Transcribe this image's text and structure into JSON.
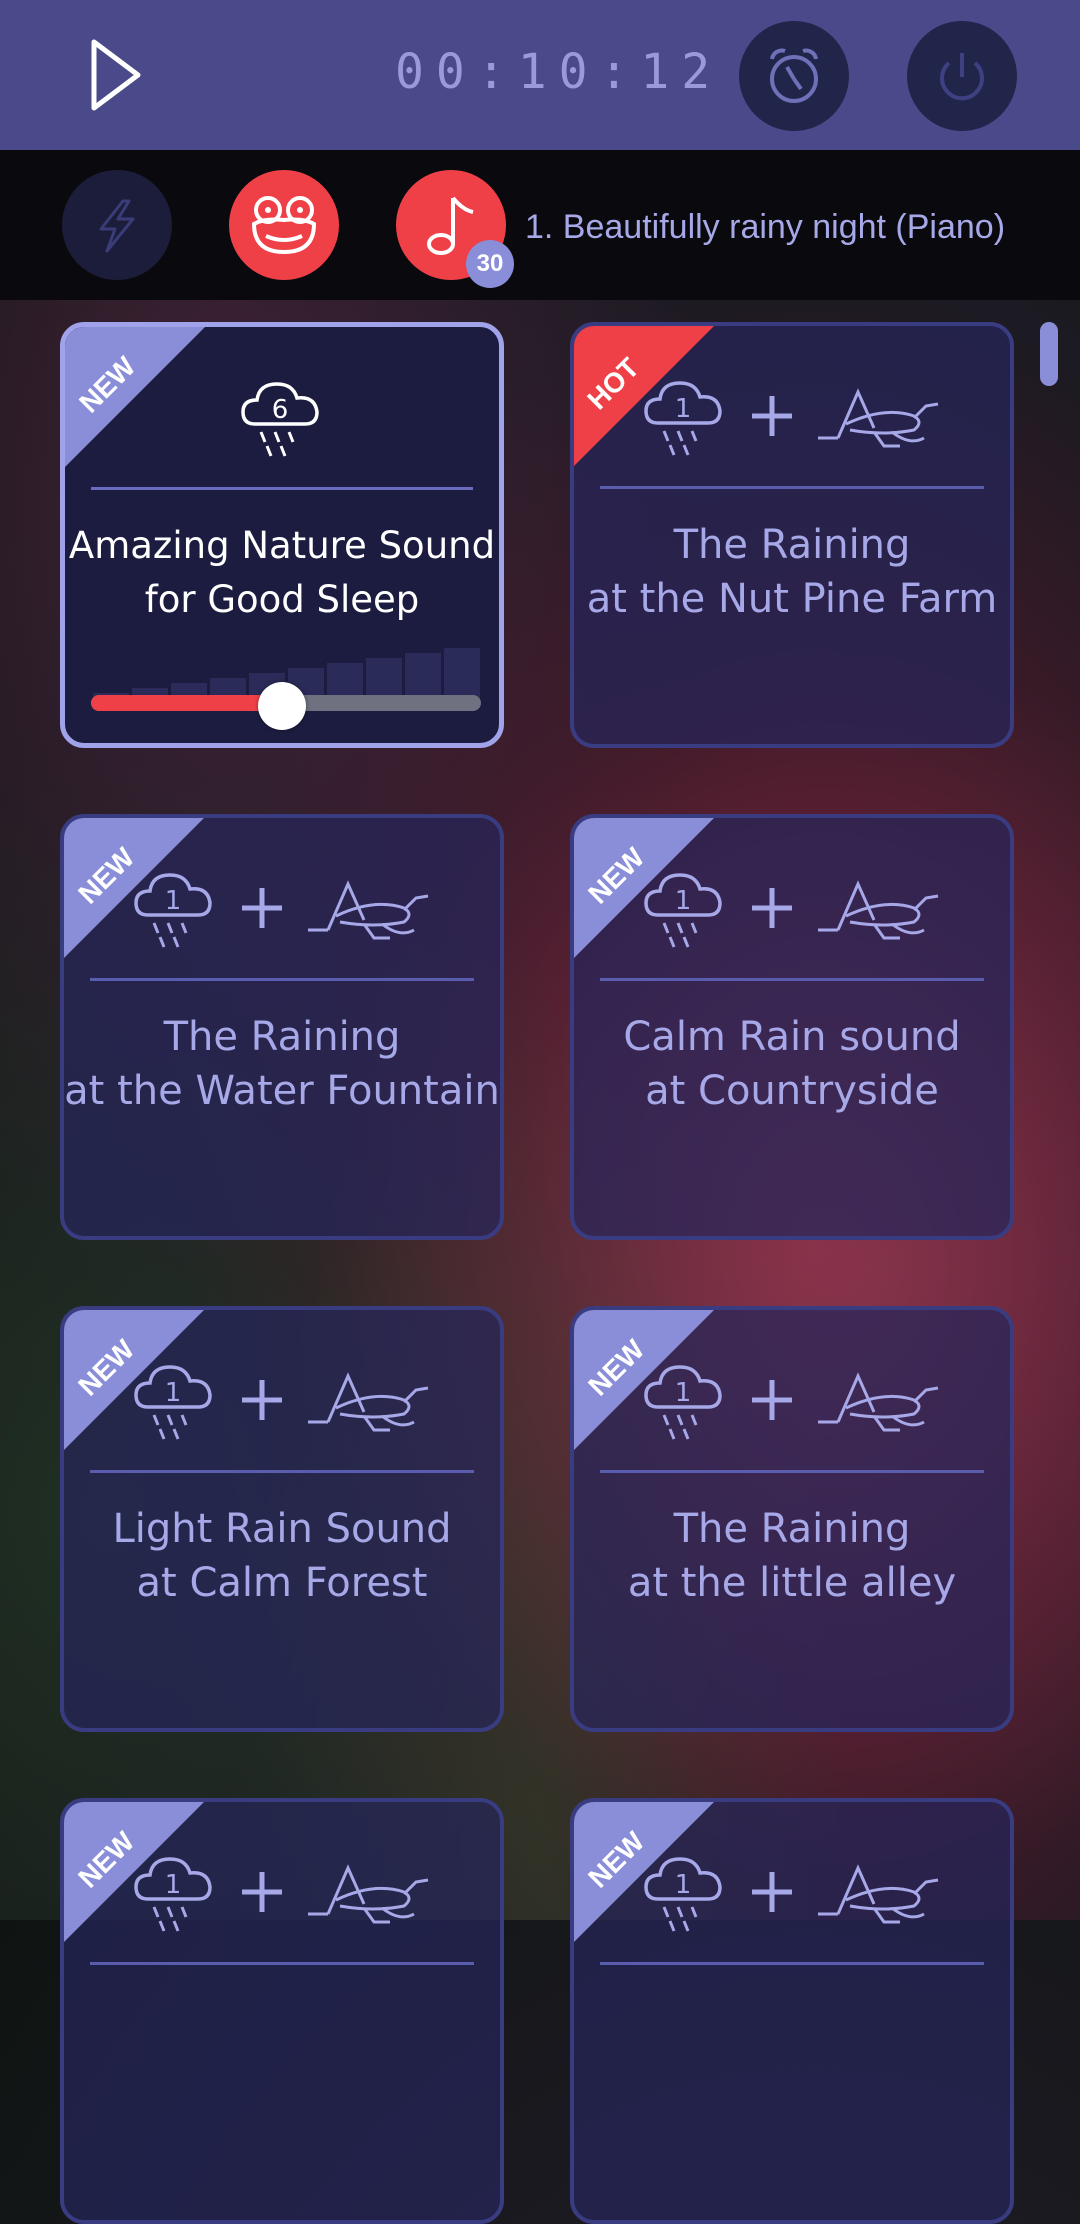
{
  "header": {
    "timer": "00:10:12"
  },
  "player": {
    "playlist_count": "30",
    "track_title": "1. Beautifully rainy night (Piano)"
  },
  "cards": [
    {
      "tag": "NEW",
      "title_line1": "Amazing Nature Sound",
      "title_line2": "for Good Sleep",
      "icon_number": "6",
      "volume": 0.49
    },
    {
      "tag": "HOT",
      "title_line1": "The Raining",
      "title_line2": "at the Nut Pine Farm",
      "icon_number": "1"
    },
    {
      "tag": "NEW",
      "title_line1": "The Raining",
      "title_line2": "at the Water Fountain",
      "icon_number": "1"
    },
    {
      "tag": "NEW",
      "title_line1": "Calm Rain sound",
      "title_line2": "at Countryside",
      "icon_number": "1"
    },
    {
      "tag": "NEW",
      "title_line1": "Light Rain Sound",
      "title_line2": "at Calm Forest",
      "icon_number": "1"
    },
    {
      "tag": "NEW",
      "title_line1": "The Raining",
      "title_line2": "at the little alley",
      "icon_number": "1"
    },
    {
      "tag": "NEW",
      "title_line1": "",
      "title_line2": "",
      "icon_number": "1"
    },
    {
      "tag": "NEW",
      "title_line1": "",
      "title_line2": "",
      "icon_number": "1"
    }
  ],
  "colors": {
    "header_bg": "#4a4a8a",
    "accent_red": "#ef4048",
    "accent_lavender": "#8a8ed8"
  },
  "icons": {
    "play": "play-icon",
    "alarm": "alarm-clock-icon",
    "power": "power-icon",
    "flash": "lightning-icon",
    "frog": "frog-icon",
    "music": "music-note-icon",
    "rain": "rain-cloud-icon",
    "plus": "plus-icon",
    "grasshopper": "grasshopper-icon"
  }
}
